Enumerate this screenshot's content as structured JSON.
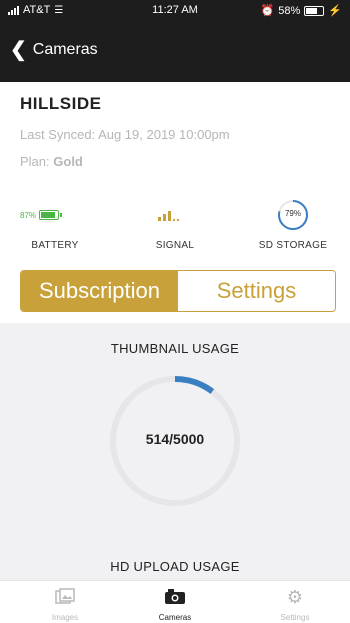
{
  "status_bar": {
    "carrier": "AT&T",
    "time": "11:27 AM",
    "battery_percent": "58%",
    "icons": [
      "signal-icon",
      "wifi-icon",
      "alarm-icon",
      "battery-icon",
      "charging-icon"
    ]
  },
  "nav": {
    "back_label": "Cameras",
    "back_icon": "chevron-left-icon"
  },
  "camera": {
    "name": "HILLSIDE",
    "last_synced_label": "Last Synced:",
    "last_synced_value": "Aug 19, 2019 10:00pm",
    "plan_label": "Plan:",
    "plan_value": "Gold"
  },
  "metrics": {
    "battery": {
      "label": "BATTERY",
      "value": "87%",
      "level": 0.87,
      "color": "#4bb543"
    },
    "signal": {
      "label": "SIGNAL",
      "bars_active": 3,
      "bars_total": 5,
      "color": "#c9a13a"
    },
    "sd_storage": {
      "label": "SD STORAGE",
      "value": "79%",
      "fraction": 0.79,
      "color": "#3a7fc1"
    }
  },
  "segmented": {
    "tabs": [
      {
        "label": "Subscription",
        "active": true
      },
      {
        "label": "Settings",
        "active": false
      }
    ],
    "accent": "#c9a13a"
  },
  "usage": {
    "thumbnail_title": "THUMBNAIL USAGE",
    "thumbnail_value": "514/5000",
    "thumbnail_used": 514,
    "thumbnail_total": 5000,
    "hd_title": "HD UPLOAD USAGE",
    "gauge_color": "#3a7fc1",
    "track_color": "#e6e6ea"
  },
  "tab_bar": {
    "items": [
      {
        "label": "Images",
        "icon": "images-icon",
        "active": false
      },
      {
        "label": "Cameras",
        "icon": "camera-icon",
        "active": true
      },
      {
        "label": "Settings",
        "icon": "gear-icon",
        "active": false
      }
    ]
  }
}
